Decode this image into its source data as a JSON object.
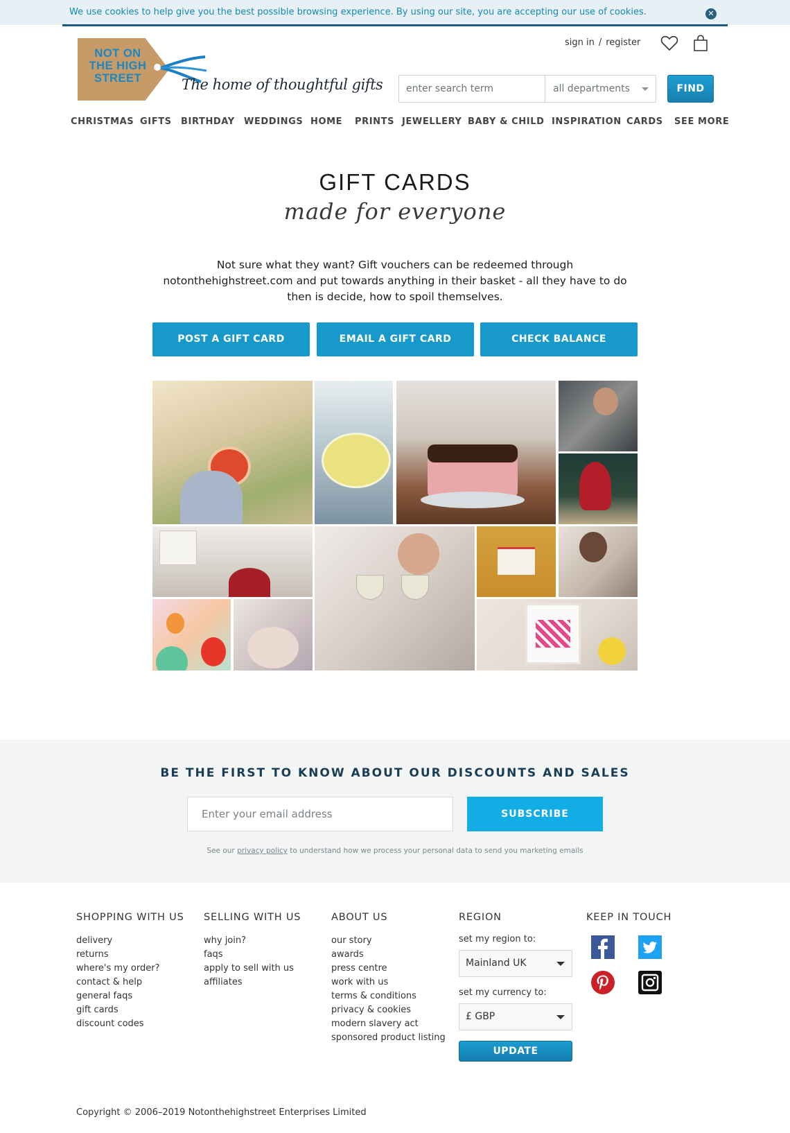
{
  "cookie_bar": {
    "text": "We use cookies to help give you the best possible browsing experience. By using our site, you are accepting our use of cookies.",
    "close_glyph": "✕"
  },
  "header": {
    "logo_text": "NOT ON THE HIGH STREET",
    "tagline": "The home of thoughtful gifts",
    "sign_in": "sign in",
    "separator": "/",
    "register": "register",
    "search": {
      "placeholder": "enter search term",
      "department": "all departments"
    },
    "find_label": "FIND"
  },
  "nav": [
    "CHRISTMAS",
    "GIFTS",
    "BIRTHDAY",
    "WEDDINGS",
    "HOME",
    "PRINTS",
    "JEWELLERY",
    "BABY & CHILD",
    "INSPIRATION",
    "CARDS",
    "SEE MORE"
  ],
  "hero": {
    "title": "GIFT CARDS",
    "script": "made for everyone",
    "description": "Not sure what they want? Gift vouchers can be redeemed through notonthehighstreet.com and put towards anything in their basket - all they have to do then is decide, how to spoil themselves.",
    "buttons": [
      "POST A GIFT CARD",
      "EMAIL A GIFT CARD",
      "CHECK BALANCE"
    ]
  },
  "newsletter": {
    "title": "BE THE FIRST TO KNOW ABOUT OUR DISCOUNTS AND SALES",
    "placeholder": "Enter your email address",
    "button": "SUBSCRIBE",
    "note_before": "See our ",
    "note_link": "privacy policy",
    "note_after": " to understand how we process your personal data to send you marketing emails"
  },
  "footer": {
    "shopping": {
      "title": "SHOPPING WITH US",
      "links": [
        "delivery",
        "returns",
        "where's my order?",
        "contact & help",
        "general faqs",
        "gift cards",
        "discount codes"
      ]
    },
    "selling": {
      "title": "SELLING WITH US",
      "links": [
        "why join?",
        "faqs",
        "apply to sell with us",
        "affiliates"
      ]
    },
    "about": {
      "title": "ABOUT US",
      "links": [
        "our story",
        "awards",
        "press centre",
        "work with us",
        "terms & conditions",
        "privacy & cookies",
        "modern slavery act",
        "sponsored product listing"
      ]
    },
    "region": {
      "title": "REGION",
      "region_label": "set my region to:",
      "region_value": "Mainland UK",
      "currency_label": "set my currency to:",
      "currency_value": "£ GBP",
      "update": "UPDATE"
    },
    "social": {
      "title": "KEEP IN TOUCH",
      "icons": [
        "facebook-icon",
        "twitter-icon",
        "pinterest-icon",
        "instagram-icon"
      ]
    },
    "copyright": "Copyright © 2006–2019 Notonthehighstreet Enterprises Limited"
  },
  "colors": {
    "accent": "#1799cc",
    "subscribe": "#12ade4",
    "heading_dark": "#1a3d56",
    "cookie_text": "#1589b4"
  }
}
